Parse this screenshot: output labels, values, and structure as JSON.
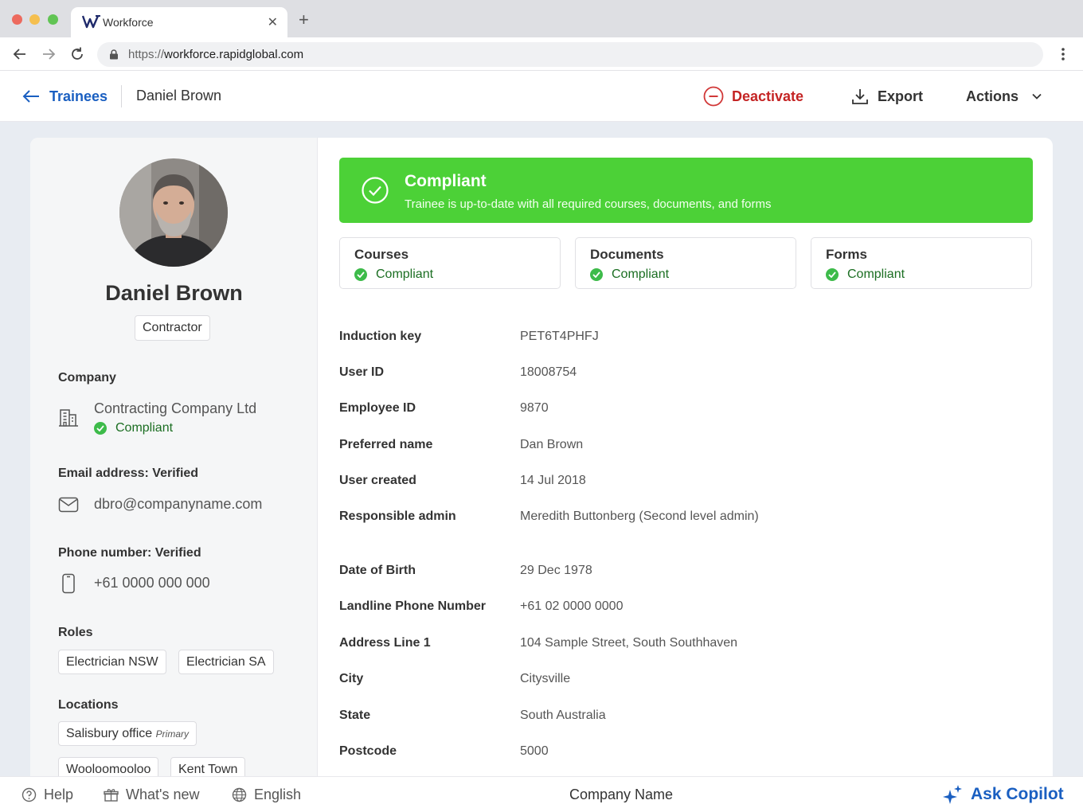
{
  "browser": {
    "tab_title": "Workforce",
    "url_scheme": "https://",
    "url_host": "workforce.rapidglobal.com",
    "icons": [
      "back-arrow-icon",
      "forward-arrow-icon",
      "reload-icon",
      "lock-icon",
      "kebab-menu-icon"
    ]
  },
  "header": {
    "back_label": "Trainees",
    "current": "Daniel Brown",
    "deactivate_label": "Deactivate",
    "export_label": "Export",
    "actions_label": "Actions"
  },
  "profile": {
    "name": "Daniel Brown",
    "type": "Contractor",
    "company": {
      "label": "Company",
      "value": "Contracting Company Ltd",
      "status": "Compliant"
    },
    "email": {
      "label": "Email address: Verified",
      "value": "dbro@companyname.com"
    },
    "phone": {
      "label": "Phone number: Verified",
      "value": "+61 0000 000 000"
    },
    "roles_label": "Roles",
    "roles": [
      "Electrician NSW",
      "Electrician SA"
    ],
    "locations_label": "Locations",
    "locations": [
      {
        "name": "Salisbury office",
        "tag": "Primary"
      },
      {
        "name": "Wooloomooloo"
      },
      {
        "name": "Kent Town"
      }
    ]
  },
  "banner": {
    "title": "Compliant",
    "subtitle": "Trainee is up-to-date with all required courses, documents, and forms"
  },
  "stats": [
    {
      "title": "Courses",
      "status": "Compliant"
    },
    {
      "title": "Documents",
      "status": "Compliant"
    },
    {
      "title": "Forms",
      "status": "Compliant"
    }
  ],
  "details": [
    {
      "label": "Induction key",
      "value": "PET6T4PHFJ"
    },
    {
      "label": "User ID",
      "value": "18008754"
    },
    {
      "label": "Employee ID",
      "value": "9870"
    },
    {
      "label": "Preferred name",
      "value": "Dan Brown"
    },
    {
      "label": "User created",
      "value": "14 Jul 2018"
    },
    {
      "label": "Responsible admin",
      "value": "Meredith Buttonberg (Second level admin)"
    },
    {
      "label": "Date of Birth",
      "value": "29 Dec 1978"
    },
    {
      "label": "Landline Phone Number",
      "value": "+61 02 0000 0000"
    },
    {
      "label": "Address Line 1",
      "value": "104 Sample Street, South Southhaven"
    },
    {
      "label": "City",
      "value": "Citysville"
    },
    {
      "label": "State",
      "value": "South Australia"
    },
    {
      "label": "Postcode",
      "value": "5000"
    }
  ],
  "footer": {
    "help": "Help",
    "whats_new": "What's new",
    "language": "English",
    "company": "Company Name",
    "copilot": "Ask Copilot"
  },
  "colors": {
    "accent": "#1a5fc1",
    "danger": "#c42424",
    "success": "#4cd137",
    "success_text": "#1b6e22"
  }
}
